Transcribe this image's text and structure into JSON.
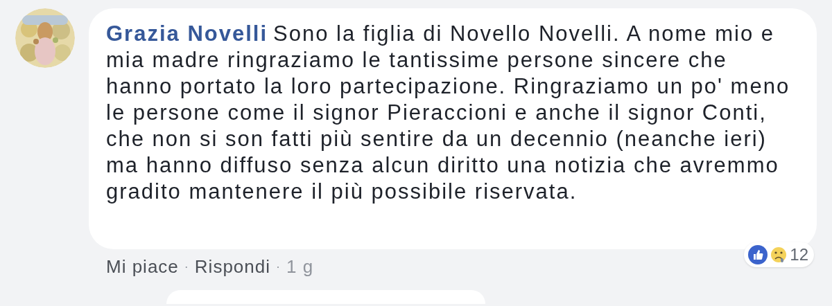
{
  "comment": {
    "author": "Grazia Novelli",
    "text": "Sono la figlia di Novello Novelli. A nome mio e mia madre ringraziamo le tantissime persone sincere che hanno portato la loro partecipazione. Ringraziamo un po' meno le persone come il signor Pieraccioni e anche il signor Conti, che non si son fatti più sentire da un decennio (neanche ieri) ma hanno diffuso senza alcun diritto una notizia che avremmo gradito mantenere il più possibile riservata.",
    "reactions": {
      "count": "12"
    },
    "actions": [
      "Mi piace",
      "Rispondi"
    ],
    "separator": "·",
    "time": "1 g"
  }
}
